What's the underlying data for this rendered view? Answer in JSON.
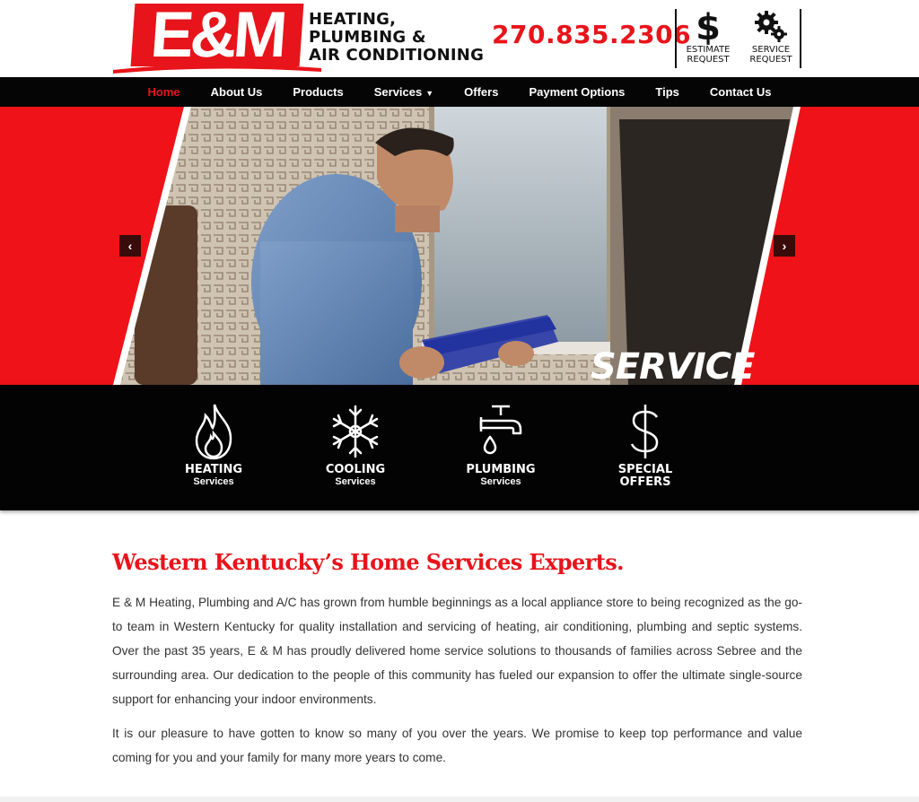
{
  "brand": {
    "logo_mark": "E&M",
    "logo_lines": [
      "HEATING,",
      "PLUMBING &",
      "AIR CONDITIONING"
    ],
    "accent_color": "#e8141b"
  },
  "header": {
    "phone": "270.835.2306",
    "estimate_line1": "ESTIMATE",
    "estimate_line2": "REQUEST",
    "estimate_icon": "dollar-icon",
    "service_line1": "SERVICE",
    "service_line2": "REQUEST",
    "service_icon": "gears-icon"
  },
  "nav": {
    "items": [
      {
        "label": "Home",
        "active": true
      },
      {
        "label": "About Us"
      },
      {
        "label": "Products"
      },
      {
        "label": "Services",
        "has_dropdown": true
      },
      {
        "label": "Offers"
      },
      {
        "label": "Payment Options"
      },
      {
        "label": "Tips"
      },
      {
        "label": "Contact Us"
      }
    ]
  },
  "hero": {
    "caption": "SERVICE",
    "prev_symbol": "‹",
    "next_symbol": "›"
  },
  "services": [
    {
      "title": "HEATING",
      "subtitle": "Services",
      "icon": "flame-icon"
    },
    {
      "title": "COOLING",
      "subtitle": "Services",
      "icon": "snowflake-icon"
    },
    {
      "title": "PLUMBING",
      "subtitle": "Services",
      "icon": "faucet-icon"
    },
    {
      "title": "SPECIAL",
      "subtitle": "OFFERS",
      "icon": "dollar-icon"
    }
  ],
  "content": {
    "headline": "Western Kentucky’s Home Services Experts.",
    "paragraph1": "E & M Heating, Plumbing and A/C has grown from humble beginnings as a local appliance store to being recognized as the go-to team in Western Kentucky for quality installation and servicing of heating, air conditioning, plumbing and septic systems. Over the past 35 years, E & M has proudly delivered home service solutions to thousands of families across Sebree and the surrounding area. Our dedication to the people of this community has fueled our expansion to offer the ultimate single-source support for enhancing your indoor environments.",
    "paragraph2": "It is our pleasure to have gotten to know so many of you over the years. We promise to keep top performance and value coming for you and your family for many more years to come."
  }
}
